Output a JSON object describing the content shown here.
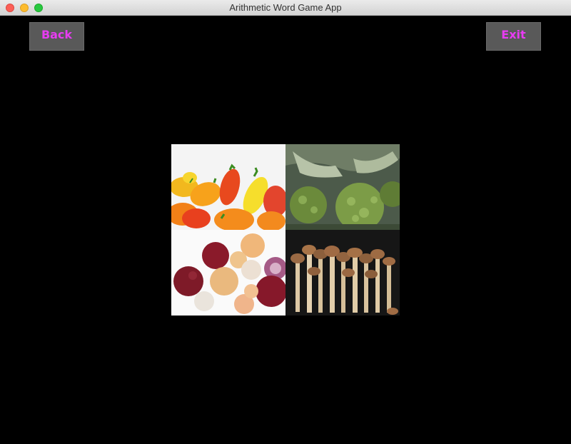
{
  "window": {
    "title": "Arithmetic Word Game App"
  },
  "toolbar": {
    "back_label": "Back",
    "exit_label": "Exit"
  },
  "colors": {
    "button_text": "#e83cf2",
    "button_bg": "#595959",
    "background": "#000000"
  },
  "images": [
    {
      "name": "peppers"
    },
    {
      "name": "broccoli"
    },
    {
      "name": "onions"
    },
    {
      "name": "mushrooms"
    }
  ]
}
